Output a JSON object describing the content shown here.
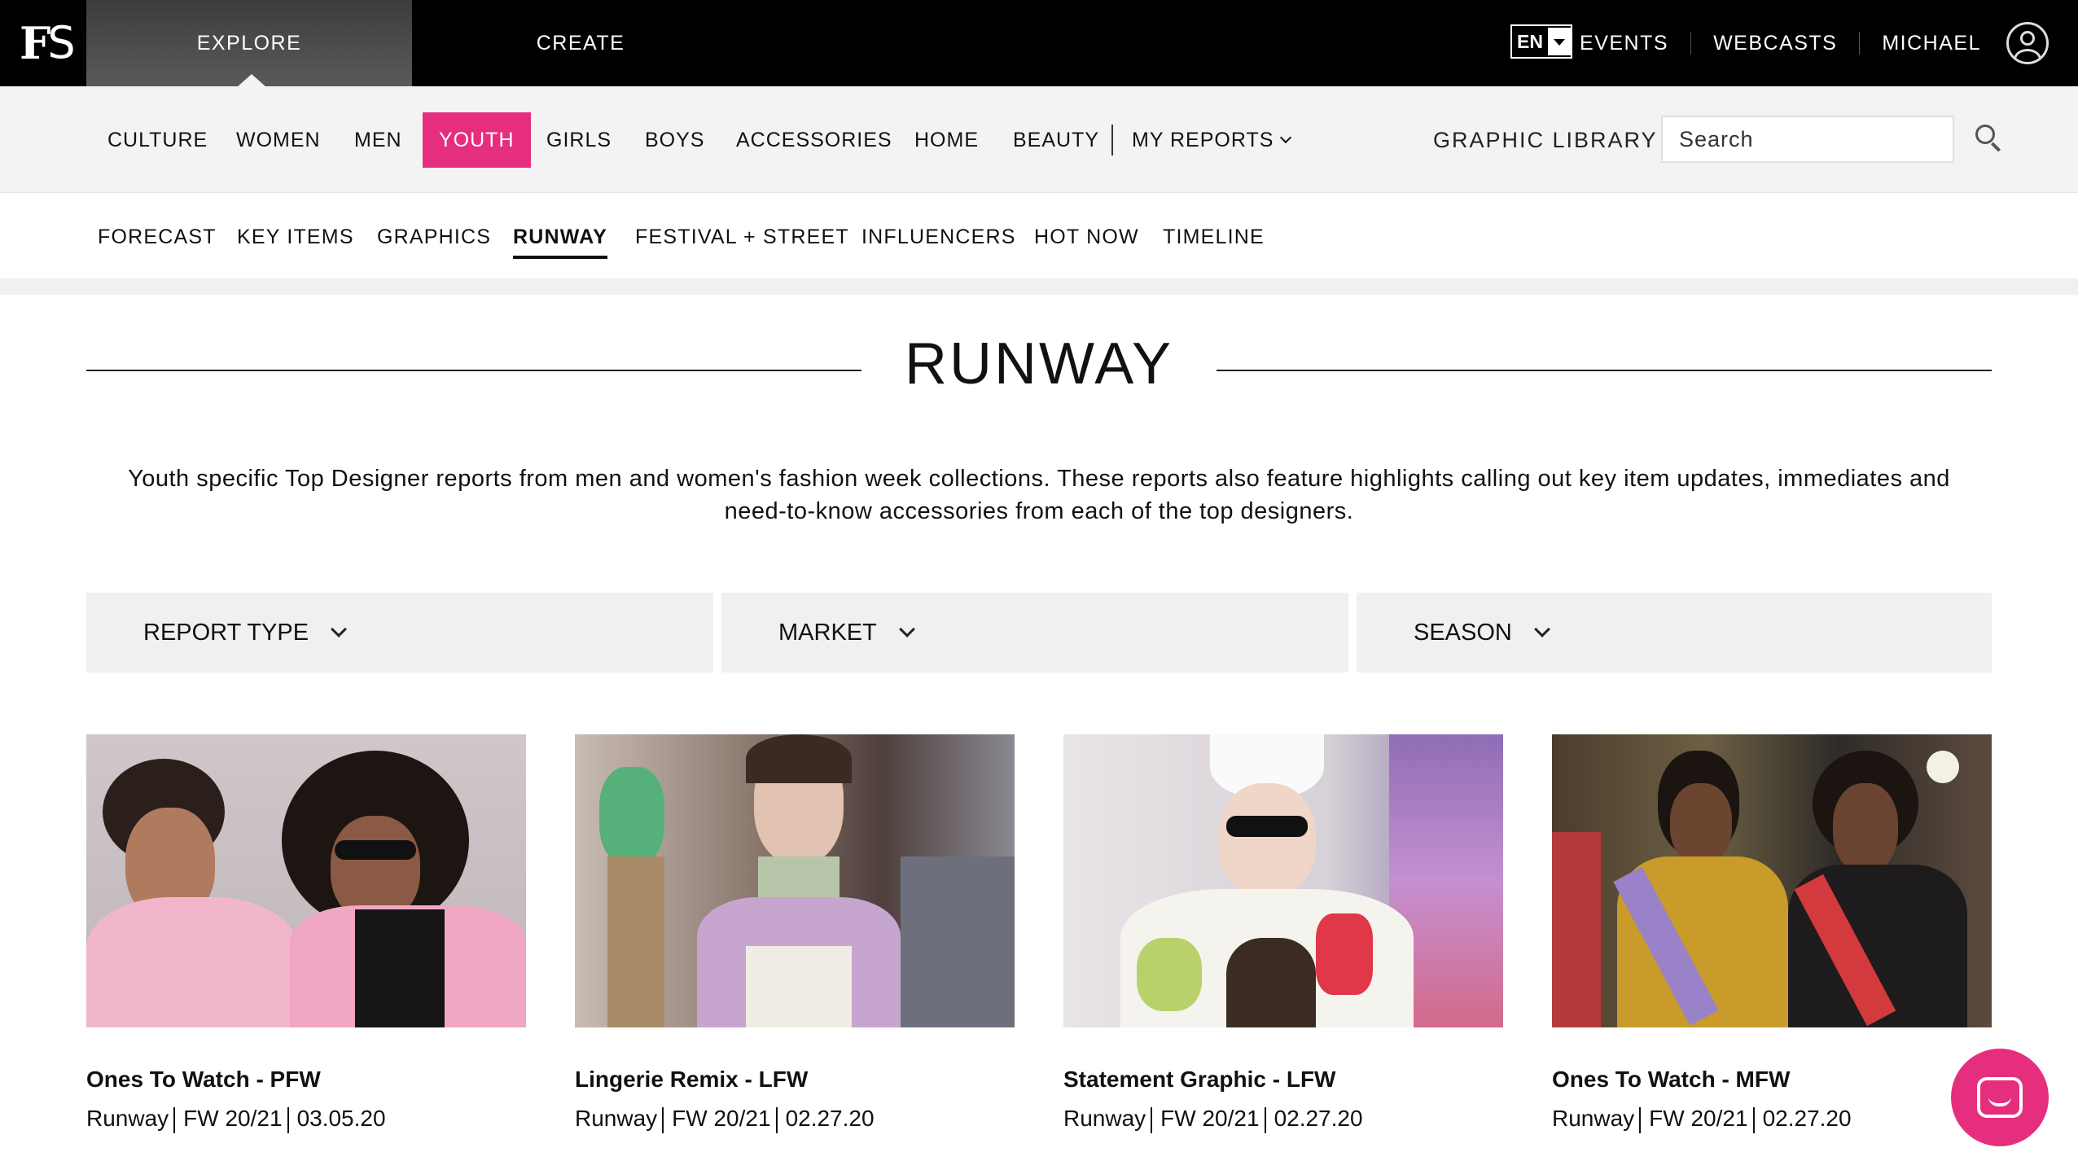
{
  "topbar": {
    "logo": {
      "f": "F",
      "s": "S"
    },
    "tabs": [
      {
        "label": "EXPLORE"
      },
      {
        "label": "CREATE"
      }
    ],
    "language": "EN",
    "links": [
      {
        "label": "EVENTS"
      },
      {
        "label": "WEBCASTS"
      }
    ],
    "user_name": "MICHAEL"
  },
  "mainnav": {
    "items": [
      {
        "label": "CULTURE"
      },
      {
        "label": "WOMEN"
      },
      {
        "label": "MEN"
      },
      {
        "label": "YOUTH"
      },
      {
        "label": "GIRLS"
      },
      {
        "label": "BOYS"
      },
      {
        "label": "ACCESSORIES"
      },
      {
        "label": "HOME"
      },
      {
        "label": "BEAUTY"
      }
    ],
    "active": "YOUTH",
    "my_reports": "MY REPORTS",
    "graphic_library": "GRAPHIC LIBRARY",
    "search_placeholder": "Search"
  },
  "subnav": {
    "items": [
      {
        "label": "FORECAST"
      },
      {
        "label": "KEY ITEMS"
      },
      {
        "label": "GRAPHICS"
      },
      {
        "label": "RUNWAY"
      },
      {
        "label": "FESTIVAL + STREET"
      },
      {
        "label": "INFLUENCERS"
      },
      {
        "label": "HOT NOW"
      },
      {
        "label": "TIMELINE"
      }
    ],
    "active": "RUNWAY"
  },
  "page": {
    "title": "RUNWAY",
    "description_line1": "Youth specific Top Designer reports from men and women's fashion week collections. These reports also feature highlights calling out key item updates, immediates and",
    "description_line2": "need-to-know accessories from each of the top designers."
  },
  "filters": [
    {
      "label": "REPORT TYPE"
    },
    {
      "label": "MARKET"
    },
    {
      "label": "SEASON"
    }
  ],
  "cards": [
    {
      "title": "Ones To Watch - PFW",
      "type": "Runway",
      "season": "FW 20/21",
      "date": "03.05.20"
    },
    {
      "title": "Lingerie Remix - LFW",
      "type": "Runway",
      "season": "FW 20/21",
      "date": "02.27.20"
    },
    {
      "title": "Statement Graphic - LFW",
      "type": "Runway",
      "season": "FW 20/21",
      "date": "02.27.20"
    },
    {
      "title": "Ones To Watch - MFW",
      "type": "Runway",
      "season": "FW 20/21",
      "date": "02.27.20"
    }
  ],
  "colors": {
    "accent": "#e62e7e",
    "topbar": "#000000",
    "nav_bg": "#f3f3f3",
    "filter_bg": "#f0f0f0"
  },
  "icons": {
    "search": "search-icon",
    "user": "user-icon",
    "chat": "chat-icon"
  }
}
